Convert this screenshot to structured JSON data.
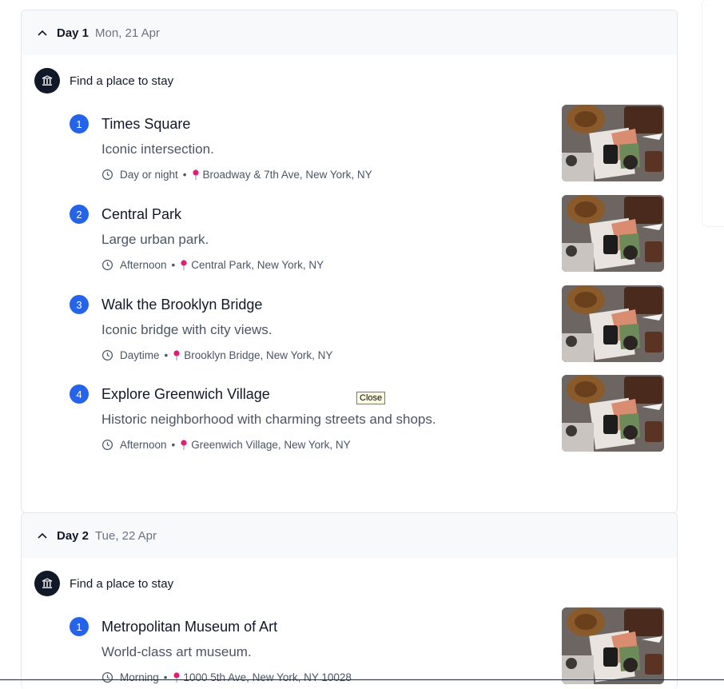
{
  "tooltip": "Close",
  "stay_label": "Find a place to stay",
  "days": [
    {
      "label": "Day 1",
      "date": "Mon, 21 Apr",
      "items": [
        {
          "num": "1",
          "title": "Times Square",
          "desc": "Iconic intersection.",
          "time": "Day or night",
          "location": "Broadway & 7th Ave, New York, NY"
        },
        {
          "num": "2",
          "title": "Central Park",
          "desc": "Large urban park.",
          "time": "Afternoon",
          "location": "Central Park, New York, NY"
        },
        {
          "num": "3",
          "title": "Walk the Brooklyn Bridge",
          "desc": "Iconic bridge with city views.",
          "time": "Daytime",
          "location": "Brooklyn Bridge, New York, NY"
        },
        {
          "num": "4",
          "title": "Explore Greenwich Village",
          "desc": "Historic neighborhood with charming streets and shops.",
          "time": "Afternoon",
          "location": "Greenwich Village, New York, NY"
        }
      ]
    },
    {
      "label": "Day 2",
      "date": "Tue, 22 Apr",
      "items": [
        {
          "num": "1",
          "title": "Metropolitan Museum of Art",
          "desc": "World-class art museum.",
          "time": "Morning",
          "location": "1000 5th Ave, New York, NY 10028"
        }
      ]
    }
  ]
}
